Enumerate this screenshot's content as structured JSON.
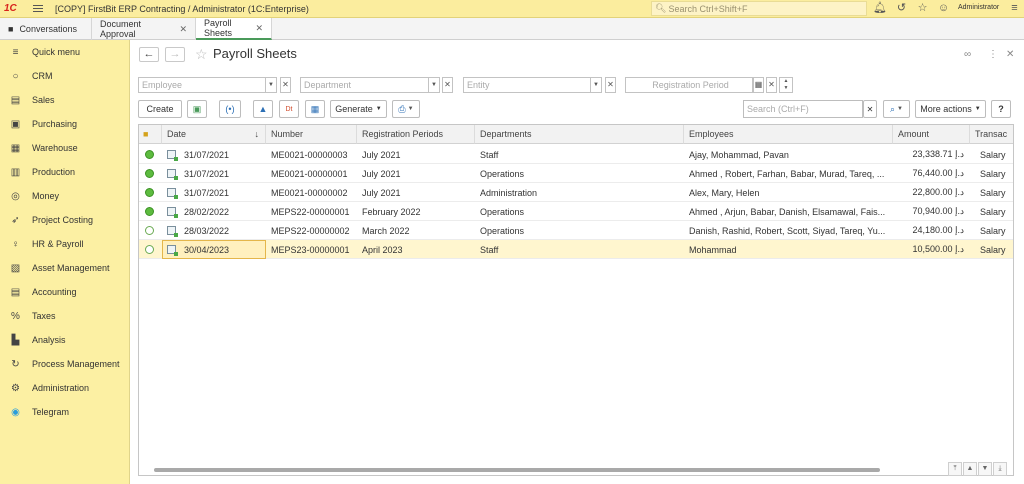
{
  "titlebar": {
    "logo": "1C",
    "title": "[COPY] FirstBit ERP Contracting / Administrator  (1C:Enterprise)",
    "search_placeholder": "Search Ctrl+Shift+F",
    "user": "Administrator"
  },
  "tabs": [
    {
      "label": "Conversations"
    },
    {
      "label": "Document Approval"
    },
    {
      "label": "Payroll Sheets"
    }
  ],
  "sidebar": {
    "items": [
      {
        "label": "Quick menu",
        "icon": "menu-icon"
      },
      {
        "label": "CRM",
        "icon": "chat-icon"
      },
      {
        "label": "Sales",
        "icon": "shop-icon"
      },
      {
        "label": "Purchasing",
        "icon": "truck-icon"
      },
      {
        "label": "Warehouse",
        "icon": "warehouse-icon"
      },
      {
        "label": "Production",
        "icon": "factory-icon"
      },
      {
        "label": "Money",
        "icon": "coins-icon"
      },
      {
        "label": "Project Costing",
        "icon": "rocket-icon"
      },
      {
        "label": "HR & Payroll",
        "icon": "person-icon"
      },
      {
        "label": "Asset Management",
        "icon": "assets-icon"
      },
      {
        "label": "Accounting",
        "icon": "ledger-icon"
      },
      {
        "label": "Taxes",
        "icon": "percent-icon"
      },
      {
        "label": "Analysis",
        "icon": "chart-icon"
      },
      {
        "label": "Process Management",
        "icon": "process-icon"
      },
      {
        "label": "Administration",
        "icon": "gear-icon"
      },
      {
        "label": "Telegram",
        "icon": "telegram-icon"
      }
    ]
  },
  "page": {
    "title": "Payroll Sheets"
  },
  "filters": {
    "employee": "Employee",
    "department": "Department",
    "entity": "Entity",
    "period": "Registration Period"
  },
  "toolbar": {
    "create": "Create",
    "generate": "Generate",
    "search_placeholder": "Search (Ctrl+F)",
    "more_actions": "More actions",
    "help": "?"
  },
  "table": {
    "columns": [
      "Date",
      "Number",
      "Registration Periods",
      "Departments",
      "Employees",
      "Amount",
      "Transac"
    ],
    "rows": [
      {
        "status": "posted",
        "date": "31/07/2021",
        "number": "ME0021-00000003",
        "period": "July 2021",
        "department": "Staff",
        "employees": "Ajay, Mohammad, Pavan",
        "amount": "23,338.71 د.إ",
        "type": "Salary"
      },
      {
        "status": "posted",
        "date": "31/07/2021",
        "number": "ME0021-00000001",
        "period": "July 2021",
        "department": "Operations",
        "employees": "Ahmed , Robert, Farhan, Babar, Murad, Tareq, ...",
        "amount": "76,440.00 د.إ",
        "type": "Salary"
      },
      {
        "status": "posted",
        "date": "31/07/2021",
        "number": "ME0021-00000002",
        "period": "July 2021",
        "department": "Administration",
        "employees": "Alex, Mary, Helen",
        "amount": "22,800.00 د.إ",
        "type": "Salary"
      },
      {
        "status": "posted",
        "date": "28/02/2022",
        "number": "MEPS22-00000001",
        "period": "February 2022",
        "department": "Operations",
        "employees": "Ahmed , Arjun, Babar, Danish, Elsamawal, Fais...",
        "amount": "70,940.00 د.إ",
        "type": "Salary"
      },
      {
        "status": "draft",
        "date": "28/03/2022",
        "number": "MEPS22-00000002",
        "period": "March 2022",
        "department": "Operations",
        "employees": "Danish, Rashid, Robert, Scott, Siyad, Tareq, Yu...",
        "amount": "24,180.00 د.إ",
        "type": "Salary"
      },
      {
        "status": "draft",
        "date": "30/04/2023",
        "number": "MEPS23-00000001",
        "period": "April 2023",
        "department": "Staff",
        "employees": "Mohammad",
        "amount": "10,500.00 د.إ",
        "type": "Salary"
      }
    ]
  }
}
